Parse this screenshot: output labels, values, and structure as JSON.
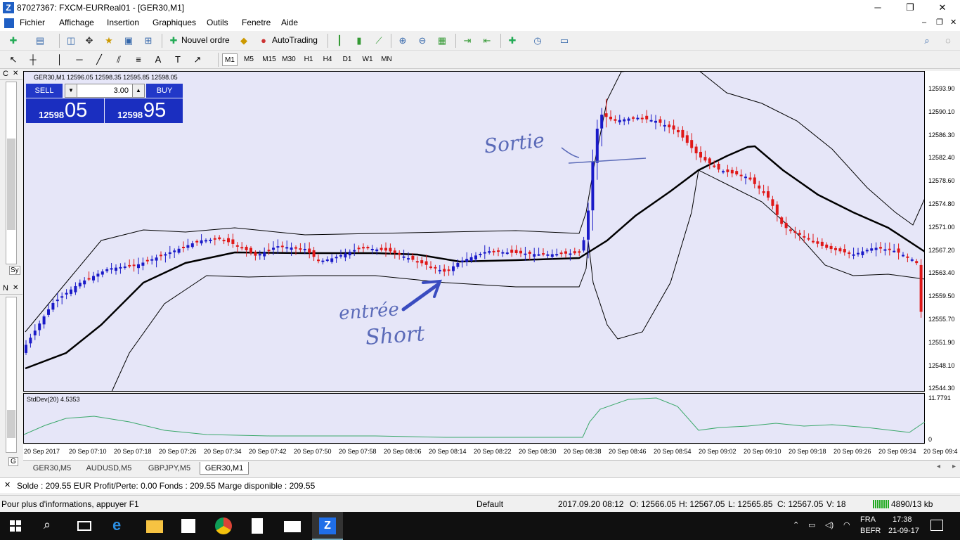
{
  "window": {
    "title": "87027367: FXCM-EURReal01 - [GER30,M1]",
    "controls": {
      "minimize": "─",
      "maximize": "❐",
      "close": "✕"
    }
  },
  "menu": [
    "Fichier",
    "Affichage",
    "Insertion",
    "Graphiques",
    "Outils",
    "Fenetre",
    "Aide"
  ],
  "toolbar": {
    "new_order": "Nouvel ordre",
    "autotrading": "AutoTrading",
    "timeframes": [
      "M1",
      "M5",
      "M15",
      "M30",
      "H1",
      "H4",
      "D1",
      "W1",
      "MN"
    ]
  },
  "chart": {
    "header": "GER30,M1  12596.05 12598.35 12595.85 12598.05",
    "trade_panel": {
      "sell": "SELL",
      "buy": "BUY",
      "volume": "3.00",
      "sell_small": "12598",
      "sell_big": "05",
      "buy_small": "12598",
      "buy_big": "95"
    },
    "annotations": {
      "sortie": "Sortie",
      "entree": "entrée",
      "short": "Short"
    },
    "price_axis": [
      "12593.90",
      "12590.10",
      "12586.30",
      "12582.40",
      "12578.60",
      "12574.80",
      "12571.00",
      "12567.20",
      "12563.40",
      "12559.50",
      "12555.70",
      "12551.90",
      "12548.10",
      "12544.30"
    ],
    "indicator_label": "StdDev(20) 4.5353",
    "indicator_axis": [
      "11.7791",
      "0"
    ],
    "time_axis": [
      "20 Sep 2017",
      "20 Sep 07:10",
      "20 Sep 07:18",
      "20 Sep 07:26",
      "20 Sep 07:34",
      "20 Sep 07:42",
      "20 Sep 07:50",
      "20 Sep 07:58",
      "20 Sep 08:06",
      "20 Sep 08:14",
      "20 Sep 08:22",
      "20 Sep 08:30",
      "20 Sep 08:38",
      "20 Sep 08:46",
      "20 Sep 08:54",
      "20 Sep 09:02",
      "20 Sep 09:10",
      "20 Sep 09:18",
      "20 Sep 09:26",
      "20 Sep 09:34",
      "20 Sep 09:4"
    ]
  },
  "chart_tabs": [
    "GER30,M5",
    "AUDUSD,M5",
    "GBPJPY,M5",
    "GER30,M1"
  ],
  "side_labels": {
    "top": "C",
    "bottom": "N",
    "sy": "Sy",
    "g": "G"
  },
  "account": "Solde : 209.55 EUR  Profit/Perte: 0.00  Fonds : 209.55  Marge disponible : 209.55",
  "status": {
    "help": "Pour plus d'informations, appuyer F1",
    "profile": "Default",
    "datetime": "2017.09.20 08:12",
    "open": "O: 12566.05",
    "high": "H: 12567.05",
    "low": "L: 12565.85",
    "close": "C: 12567.05",
    "volume": "V: 18",
    "traffic": "4890/13 kb"
  },
  "taskbar": {
    "lang1": "FRA",
    "lang2": "BEFR",
    "time": "17:38",
    "date": "21-09-17"
  },
  "colors": {
    "bull": "#1a1ac8",
    "bear": "#e01818",
    "chart_bg": "#e6e6f8",
    "stddev": "#3aa86a"
  }
}
